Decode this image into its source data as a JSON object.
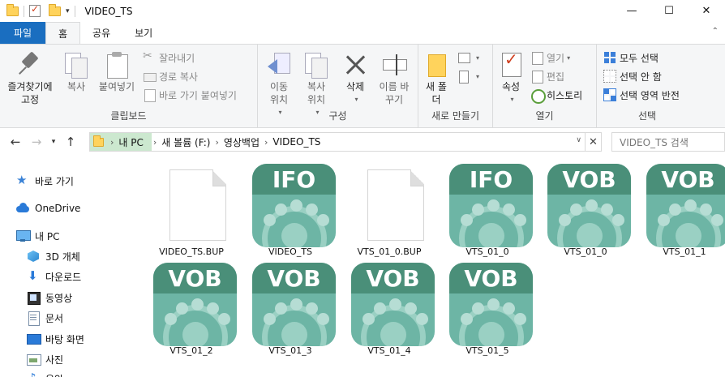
{
  "titlebar": {
    "title": "VIDEO_TS",
    "minimize": "—",
    "maximize": "☐",
    "close": "✕"
  },
  "ribbon_tabs": {
    "file": "파일",
    "home": "홈",
    "share": "공유",
    "view": "보기"
  },
  "ribbon": {
    "clipboard": {
      "label": "클립보드",
      "pin": "즐겨찾기에 고정",
      "copy": "복사",
      "paste": "붙여넣기",
      "cut": "잘라내기",
      "copy_path": "경로 복사",
      "paste_shortcut": "바로 가기 붙여넣기"
    },
    "organize": {
      "label": "구성",
      "move_to": "이동 위치",
      "copy_to": "복사 위치",
      "delete": "삭제",
      "rename": "이름 바꾸기"
    },
    "new": {
      "label": "새로 만들기",
      "new_folder": "새 폴더"
    },
    "open": {
      "label": "열기",
      "properties": "속성",
      "open": "열기",
      "edit": "편집",
      "history": "히스토리"
    },
    "select": {
      "label": "선택",
      "select_all": "모두 선택",
      "select_none": "선택 안 함",
      "invert": "선택 영역 반전"
    }
  },
  "address": {
    "crumbs": [
      "내 PC",
      "새 볼륨 (F:)",
      "영상백업",
      "VIDEO_TS"
    ],
    "search_placeholder": "VIDEO_TS 검색"
  },
  "nav": {
    "quick_access": "바로 가기",
    "onedrive": "OneDrive",
    "this_pc": "내 PC",
    "objects3d": "3D 개체",
    "downloads": "다운로드",
    "videos": "동영상",
    "documents": "문서",
    "desktop": "바탕 화면",
    "pictures": "사진",
    "music": "음악"
  },
  "files": [
    {
      "name": "VIDEO_TS.BUP",
      "type": "doc"
    },
    {
      "name": "VIDEO_TS",
      "type": "app",
      "badge": "IFO"
    },
    {
      "name": "VTS_01_0.BUP",
      "type": "doc"
    },
    {
      "name": "VTS_01_0",
      "type": "app",
      "badge": "IFO"
    },
    {
      "name": "VTS_01_0",
      "type": "app",
      "badge": "VOB"
    },
    {
      "name": "VTS_01_1",
      "type": "app",
      "badge": "VOB"
    },
    {
      "name": "VTS_01_2",
      "type": "app",
      "badge": "VOB"
    },
    {
      "name": "VTS_01_3",
      "type": "app",
      "badge": "VOB"
    },
    {
      "name": "VTS_01_4",
      "type": "app",
      "badge": "VOB"
    },
    {
      "name": "VTS_01_5",
      "type": "app",
      "badge": "VOB"
    }
  ],
  "colors": {
    "file_tab": "#1a6ec0",
    "app_icon_body": "#6db5a5",
    "app_icon_band": "#4a8f79",
    "address_highlight": "#cce8cf"
  }
}
